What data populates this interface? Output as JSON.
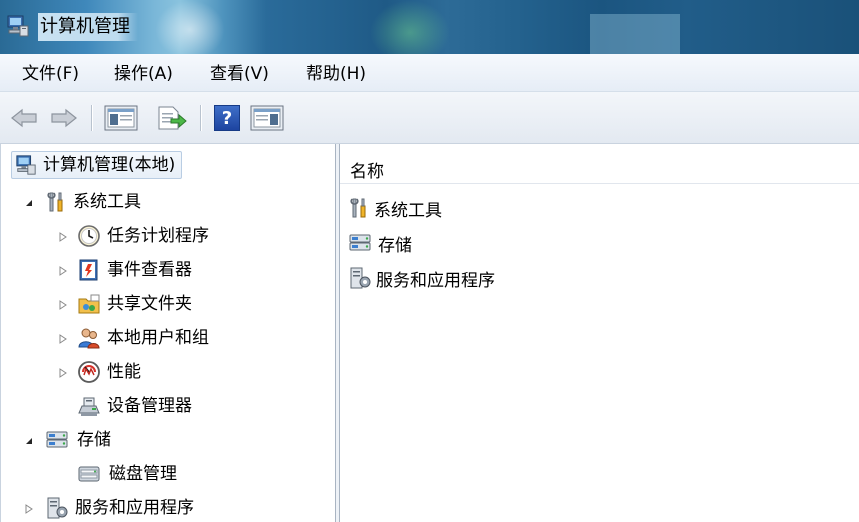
{
  "window": {
    "title": "计算机管理"
  },
  "menu": {
    "items": [
      "文件(F)",
      "操作(A)",
      "查看(V)",
      "帮助(H)"
    ]
  },
  "toolbar": {
    "buttons": [
      "back-arrow-icon",
      "forward-arrow-icon",
      "show-hide-console-tree-icon",
      "export-list-icon",
      "help-icon",
      "show-hide-action-pane-icon"
    ],
    "help_glyph": "?"
  },
  "tree": {
    "root": "计算机管理(本地)",
    "system_tools": {
      "label": "系统工具",
      "children": [
        "任务计划程序",
        "事件查看器",
        "共享文件夹",
        "本地用户和组",
        "性能",
        "设备管理器"
      ]
    },
    "storage": {
      "label": "存储",
      "children": [
        "磁盘管理"
      ]
    },
    "services": {
      "label": "服务和应用程序"
    }
  },
  "list": {
    "column_name": "名称",
    "items": [
      "系统工具",
      "存储",
      "服务和应用程序"
    ]
  }
}
